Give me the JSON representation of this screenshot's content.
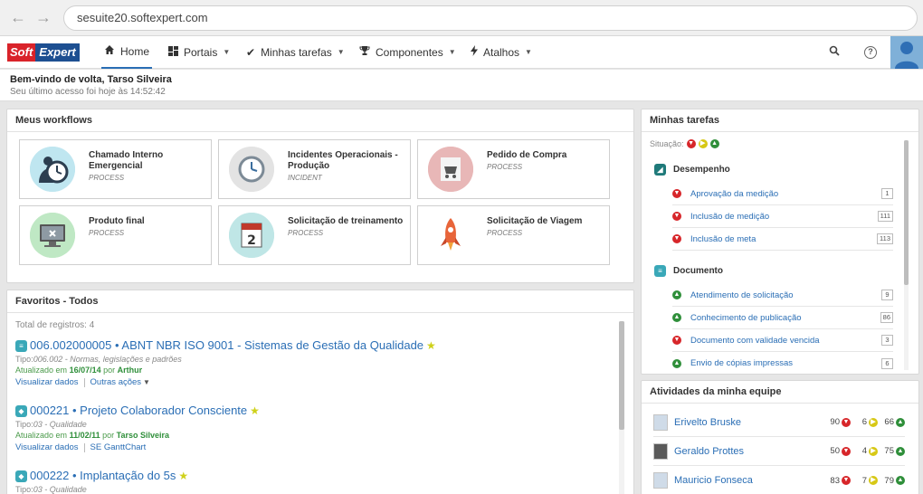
{
  "browser": {
    "url": "sesuite20.softexpert.com"
  },
  "logo": {
    "part1": "Soft",
    "part2": "Expert"
  },
  "menu": {
    "home": "Home",
    "portais": "Portais",
    "minhas_tarefas": "Minhas tarefas",
    "componentes": "Componentes",
    "atalhos": "Atalhos"
  },
  "welcome": {
    "title": "Bem-vindo de volta, Tarso Silveira",
    "last_access": "Seu último acesso foi hoje às 14:52:42"
  },
  "workflows": {
    "title": "Meus workflows",
    "items": [
      {
        "name": "Chamado Interno Emergencial",
        "type": "PROCESS"
      },
      {
        "name": "Incidentes Operacionais - Produção",
        "type": "INCIDENT"
      },
      {
        "name": "Pedido de Compra",
        "type": "PROCESS"
      },
      {
        "name": "Produto final",
        "type": "PROCESS"
      },
      {
        "name": "Solicitação de treinamento",
        "type": "PROCESS"
      },
      {
        "name": "Solicitação de Viagem",
        "type": "PROCESS"
      }
    ]
  },
  "favorites": {
    "title": "Favoritos - Todos",
    "total": "Total de registros: 4",
    "items": [
      {
        "title": "006.002000005 • ABNT NBR ISO 9001 - Sistemas de Gestão da Qualidade",
        "type_label": "Tipo:",
        "type_value": "006.002 - Normas, legislações e padrões",
        "updated_label": "Atualizado em",
        "updated_date": "16/07/14",
        "by_label": "por",
        "by_user": "Arthur",
        "link1": "Visualizar dados",
        "link2": "Outras ações"
      },
      {
        "title": "000221 • Projeto Colaborador Consciente",
        "type_label": "Tipo:",
        "type_value": "03 - Qualidade",
        "updated_label": "Atualizado em",
        "updated_date": "11/02/11",
        "by_label": "por",
        "by_user": "Tarso Silveira",
        "link1": "Visualizar dados",
        "link2": "SE GanttChart"
      },
      {
        "title": "000222 • Implantação do 5s",
        "type_label": "Tipo:",
        "type_value": "03 - Qualidade"
      }
    ]
  },
  "tasks": {
    "title": "Minhas tarefas",
    "status_label": "Situação:",
    "groups": [
      {
        "name": "Desempenho",
        "color": "#1f7a7a",
        "items": [
          {
            "name": "Aprovação da medição",
            "count": "1",
            "status": "red"
          },
          {
            "name": "Inclusão de medição",
            "count": "111",
            "status": "red"
          },
          {
            "name": "Inclusão de meta",
            "count": "113",
            "status": "red"
          }
        ]
      },
      {
        "name": "Documento",
        "color": "#3aa8b8",
        "items": [
          {
            "name": "Atendimento de solicitação",
            "count": "9",
            "status": "green"
          },
          {
            "name": "Conhecimento de publicação",
            "count": "86",
            "status": "green"
          },
          {
            "name": "Documento com validade vencida",
            "count": "3",
            "status": "red"
          },
          {
            "name": "Envio de cópias impressas",
            "count": "6",
            "status": "green"
          }
        ]
      }
    ]
  },
  "team": {
    "title": "Atividades da minha equipe",
    "members": [
      {
        "name": "Erivelto Bruske",
        "red": "90",
        "yellow": "6",
        "green": "66"
      },
      {
        "name": "Geraldo Prottes",
        "red": "50",
        "yellow": "4",
        "green": "75"
      },
      {
        "name": "Mauricio Fonseca",
        "red": "83",
        "yellow": "7",
        "green": "79"
      }
    ]
  },
  "colors": {
    "accent": "#2a6eb5",
    "red": "#d7262a",
    "yellow": "#d7c815",
    "green": "#2f8f3a"
  }
}
